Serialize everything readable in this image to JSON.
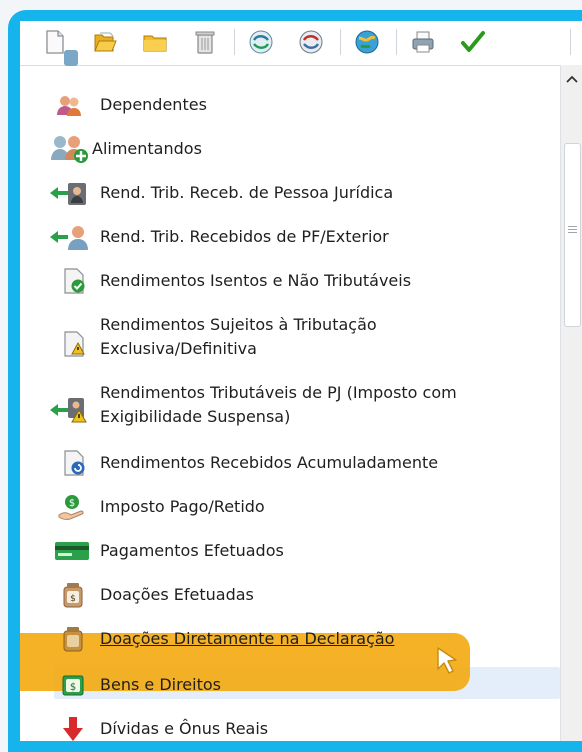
{
  "toolbar": {
    "buttons": [
      {
        "icon": "new-document-icon"
      },
      {
        "icon": "open-folder-icon"
      },
      {
        "icon": "folder-icon"
      },
      {
        "icon": "trash-icon"
      },
      {
        "icon": "transmit-icon"
      },
      {
        "icon": "receive-icon"
      },
      {
        "icon": "globe-icon"
      },
      {
        "icon": "print-icon"
      },
      {
        "icon": "checkmark-icon"
      }
    ]
  },
  "list": {
    "items": [
      {
        "label": "Dependentes",
        "icon": "dependents-icon"
      },
      {
        "label": "Alimentandos",
        "icon": "alimentandos-icon"
      },
      {
        "label": "Rend. Trib. Receb. de Pessoa Jurídica",
        "icon": "income-pj-icon"
      },
      {
        "label": "Rend. Trib. Recebidos de PF/Exterior",
        "icon": "income-pf-icon"
      },
      {
        "label": "Rendimentos Isentos e Não Tributáveis",
        "icon": "exempt-income-icon"
      },
      {
        "label": "Rendimentos Sujeitos à Tributação",
        "label2": "Exclusiva/Definitiva",
        "icon": "exclusive-tax-icon"
      },
      {
        "label": "Rendimentos Tributáveis de PJ (Imposto com",
        "label2": "Exigibilidade Suspensa)",
        "icon": "suspended-tax-icon"
      },
      {
        "label": "Rendimentos Recebidos Acumuladamente",
        "icon": "accumulated-income-icon"
      },
      {
        "label": "Imposto Pago/Retido",
        "icon": "tax-paid-icon"
      },
      {
        "label": "Pagamentos Efetuados",
        "icon": "payments-icon"
      },
      {
        "label": "Doações Efetuadas",
        "icon": "donations-icon"
      },
      {
        "label": "Doações Diretamente na Declaração",
        "icon": "direct-donations-icon"
      },
      {
        "label": "Bens e Direitos",
        "icon": "assets-icon"
      },
      {
        "label": "Dívidas e Ônus Reais",
        "icon": "debts-icon"
      }
    ]
  },
  "colors": {
    "frame": "#16b4ec",
    "highlight": "#f5a400",
    "selected_row": "#e4eefa"
  }
}
